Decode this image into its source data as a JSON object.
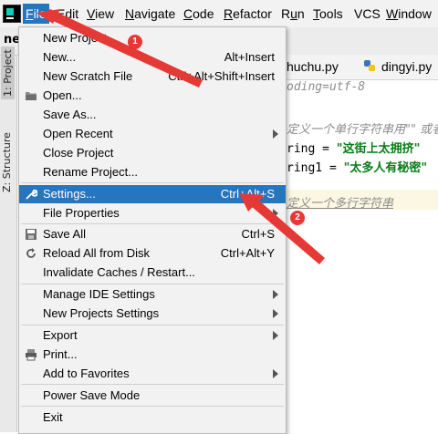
{
  "menubar": {
    "items": [
      {
        "label": "File",
        "mnemonic": "F",
        "rest": "ile",
        "active": true
      },
      {
        "label": "Edit",
        "mnemonic": "E",
        "rest": "dit"
      },
      {
        "label": "View",
        "mnemonic": "V",
        "rest": "iew"
      },
      {
        "label": "Navigate",
        "mnemonic": "N",
        "rest": "avigate"
      },
      {
        "label": "Code",
        "mnemonic": "C",
        "rest": "ode"
      },
      {
        "label": "Refactor",
        "mnemonic": "R",
        "rest": "efactor"
      },
      {
        "label": "Run",
        "pre": "R",
        "mnemonic": "u",
        "rest": "n"
      },
      {
        "label": "Tools",
        "mnemonic": "T",
        "rest": "ools"
      },
      {
        "label": "VCS",
        "mnemonic": "",
        "rest": "VCS"
      },
      {
        "label": "Window",
        "mnemonic": "W",
        "rest": "indow"
      }
    ]
  },
  "project_label": "new",
  "tabs": [
    {
      "label": "huchu.py"
    },
    {
      "label": "dingyi.py"
    }
  ],
  "side_tools": {
    "project": "1: Project",
    "structure": "Z: Structure"
  },
  "editor": {
    "line1": "oding=utf-8",
    "line2": "定义一个单行字符串用\"\" 或者",
    "line3_ident": "ring = ",
    "line3_str": "\"这街上太拥挤\"",
    "line4_ident": "ring1 = ",
    "line4_str": "\"太多人有秘密\"",
    "line5": "定义一个多行字符串"
  },
  "file_menu": {
    "items": [
      {
        "label": "New Project...",
        "shortcut": "",
        "icon": ""
      },
      {
        "label": "New...",
        "shortcut": "Alt+Insert",
        "icon": ""
      },
      {
        "label": "New Scratch File",
        "shortcut": "Ctrl+Alt+Shift+Insert",
        "icon": ""
      },
      {
        "label": "Open...",
        "shortcut": "",
        "icon": "folder-icon"
      },
      {
        "label": "Save As...",
        "shortcut": "",
        "icon": ""
      },
      {
        "label": "Open Recent",
        "shortcut": "",
        "icon": "",
        "submenu": true
      },
      {
        "label": "Close Project",
        "shortcut": "",
        "icon": ""
      },
      {
        "label": "Rename Project...",
        "shortcut": "",
        "icon": ""
      },
      {
        "label": "Settings...",
        "shortcut": "Ctrl+Alt+S",
        "icon": "wrench-icon",
        "highlighted": true
      },
      {
        "label": "File Properties",
        "shortcut": "",
        "icon": "",
        "submenu": true
      },
      {
        "label": "Save All",
        "shortcut": "Ctrl+S",
        "icon": "save-icon"
      },
      {
        "label": "Reload All from Disk",
        "shortcut": "Ctrl+Alt+Y",
        "icon": "reload-icon"
      },
      {
        "label": "Invalidate Caches / Restart...",
        "shortcut": "",
        "icon": ""
      },
      {
        "label": "Manage IDE Settings",
        "shortcut": "",
        "icon": "",
        "submenu": true
      },
      {
        "label": "New Projects Settings",
        "shortcut": "",
        "icon": "",
        "submenu": true
      },
      {
        "label": "Export",
        "shortcut": "",
        "icon": "",
        "submenu": true
      },
      {
        "label": "Print...",
        "shortcut": "",
        "icon": "print-icon"
      },
      {
        "label": "Add to Favorites",
        "shortcut": "",
        "icon": "",
        "submenu": true
      },
      {
        "label": "Power Save Mode",
        "shortcut": "",
        "icon": ""
      },
      {
        "label": "Exit",
        "shortcut": "",
        "icon": ""
      }
    ]
  },
  "annotations": {
    "badge1": "1",
    "badge2": "2",
    "color": "#e53935"
  },
  "colors": {
    "highlight": "#2675bf",
    "menu_bg": "#f2f2f2",
    "string_green": "#067d17"
  }
}
